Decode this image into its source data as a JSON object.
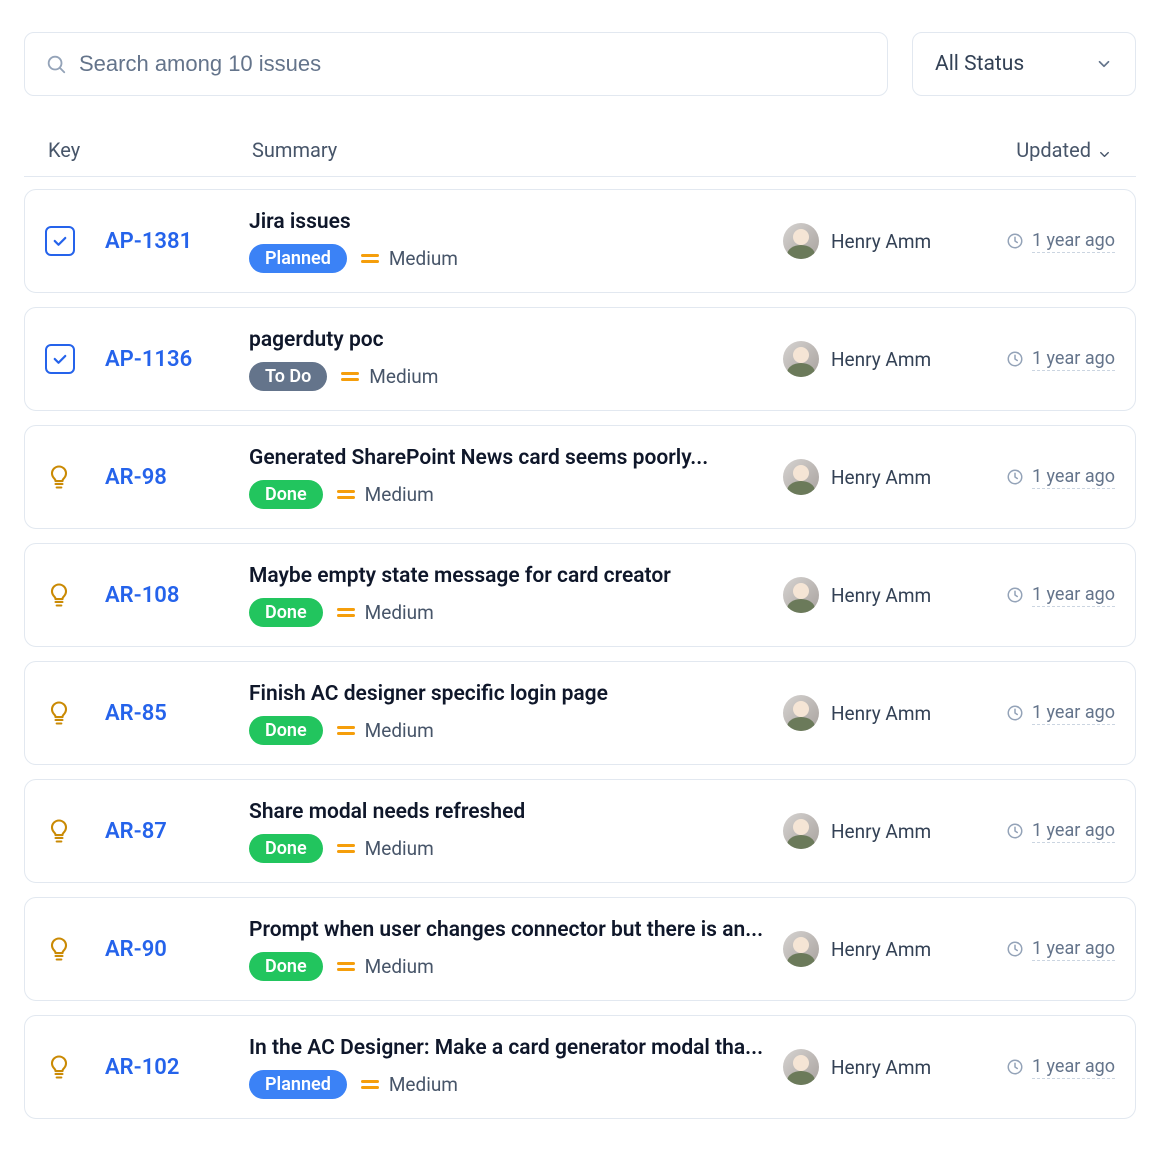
{
  "toolbar": {
    "search_placeholder": "Search among 10 issues",
    "status_filter_label": "All Status"
  },
  "headers": {
    "key": "Key",
    "summary": "Summary",
    "updated": "Updated"
  },
  "status_labels": {
    "planned": "Planned",
    "todo": "To Do",
    "done": "Done"
  },
  "priority_labels": {
    "medium": "Medium"
  },
  "issues": [
    {
      "type": "task",
      "key": "AP-1381",
      "summary": "Jira issues",
      "status": "planned",
      "priority": "medium",
      "assignee": "Henry Amm",
      "updated": "1 year ago"
    },
    {
      "type": "task",
      "key": "AP-1136",
      "summary": "pagerduty poc",
      "status": "todo",
      "priority": "medium",
      "assignee": "Henry Amm",
      "updated": "1 year ago"
    },
    {
      "type": "idea",
      "key": "AR-98",
      "summary": "Generated SharePoint News card seems poorly...",
      "status": "done",
      "priority": "medium",
      "assignee": "Henry Amm",
      "updated": "1 year ago"
    },
    {
      "type": "idea",
      "key": "AR-108",
      "summary": "Maybe empty state message for card creator",
      "status": "done",
      "priority": "medium",
      "assignee": "Henry Amm",
      "updated": "1 year ago"
    },
    {
      "type": "idea",
      "key": "AR-85",
      "summary": "Finish AC designer specific login page",
      "status": "done",
      "priority": "medium",
      "assignee": "Henry Amm",
      "updated": "1 year ago"
    },
    {
      "type": "idea",
      "key": "AR-87",
      "summary": "Share modal needs refreshed",
      "status": "done",
      "priority": "medium",
      "assignee": "Henry Amm",
      "updated": "1 year ago"
    },
    {
      "type": "idea",
      "key": "AR-90",
      "summary": "Prompt when user changes connector but there is an...",
      "status": "done",
      "priority": "medium",
      "assignee": "Henry Amm",
      "updated": "1 year ago"
    },
    {
      "type": "idea",
      "key": "AR-102",
      "summary": "In the AC Designer: Make a card generator modal tha...",
      "status": "planned",
      "priority": "medium",
      "assignee": "Henry Amm",
      "updated": "1 year ago"
    }
  ]
}
